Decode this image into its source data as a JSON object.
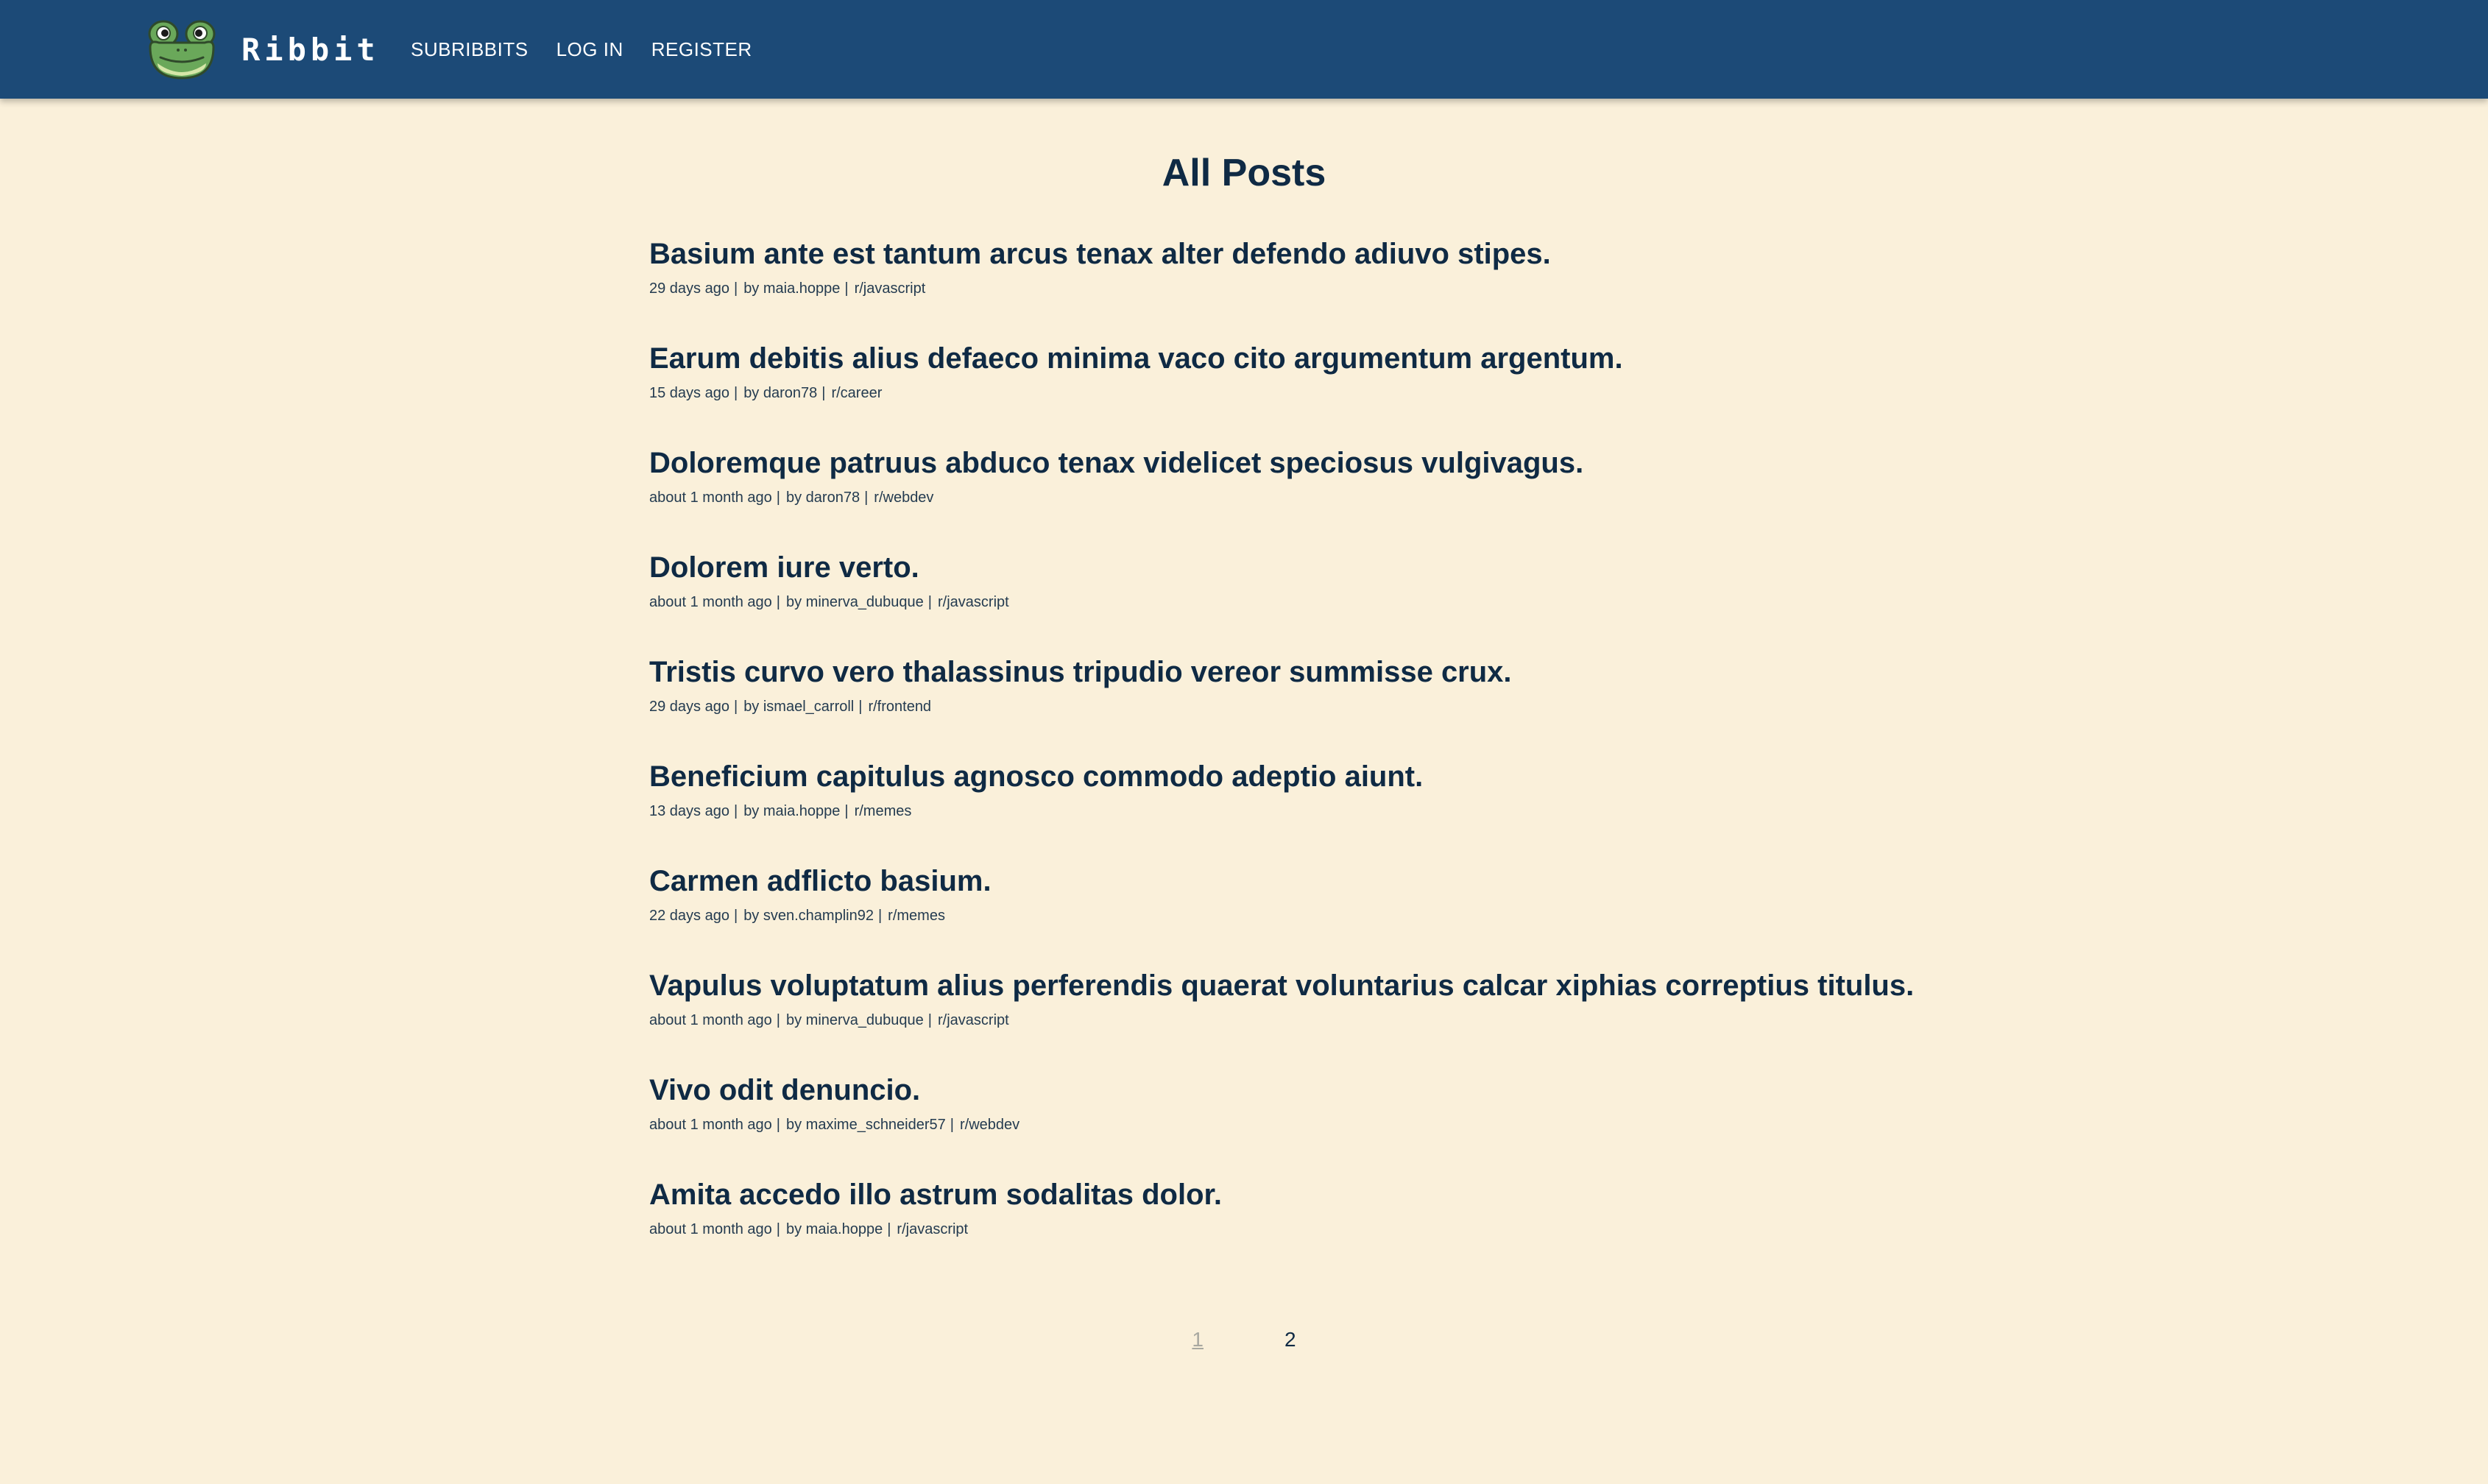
{
  "header": {
    "brand": "Ribbit",
    "nav": [
      "SUBRIBBITS",
      "LOG IN",
      "REGISTER"
    ]
  },
  "main": {
    "title": "All Posts",
    "posts": [
      {
        "title": "Basium ante est tantum arcus tenax alter defendo adiuvo stipes.",
        "time": "29 days ago",
        "author": "by maia.hoppe",
        "subribbit": "r/javascript"
      },
      {
        "title": "Earum debitis alius defaeco minima vaco cito argumentum argentum.",
        "time": "15 days ago",
        "author": "by daron78",
        "subribbit": "r/career"
      },
      {
        "title": "Doloremque patruus abduco tenax videlicet speciosus vulgivagus.",
        "time": "about 1 month ago",
        "author": "by daron78",
        "subribbit": "r/webdev"
      },
      {
        "title": "Dolorem iure verto.",
        "time": "about 1 month ago",
        "author": "by minerva_dubuque",
        "subribbit": "r/javascript"
      },
      {
        "title": "Tristis curvo vero thalassinus tripudio vereor summisse crux.",
        "time": "29 days ago",
        "author": "by ismael_carroll",
        "subribbit": "r/frontend"
      },
      {
        "title": "Beneficium capitulus agnosco commodo adeptio aiunt.",
        "time": "13 days ago",
        "author": "by maia.hoppe",
        "subribbit": "r/memes"
      },
      {
        "title": "Carmen adflicto basium.",
        "time": "22 days ago",
        "author": "by sven.champlin92",
        "subribbit": "r/memes"
      },
      {
        "title": "Vapulus voluptatum alius perferendis quaerat voluntarius calcar xiphias correptius titulus.",
        "time": "about 1 month ago",
        "author": "by minerva_dubuque",
        "subribbit": "r/javascript"
      },
      {
        "title": "Vivo odit denuncio.",
        "time": "about 1 month ago",
        "author": "by maxime_schneider57",
        "subribbit": "r/webdev"
      },
      {
        "title": "Amita accedo illo astrum sodalitas dolor.",
        "time": "about 1 month ago",
        "author": "by maia.hoppe",
        "subribbit": "r/javascript"
      }
    ],
    "meta_separator": "|"
  },
  "pagination": {
    "pages": [
      "1",
      "2"
    ],
    "current": "1"
  },
  "colors": {
    "navbar": "#1c4a77",
    "background": "#faf0da",
    "text": "#0f2a44",
    "frog": "#6aa85a"
  },
  "icons": {
    "logo": "frog-logo-icon"
  }
}
